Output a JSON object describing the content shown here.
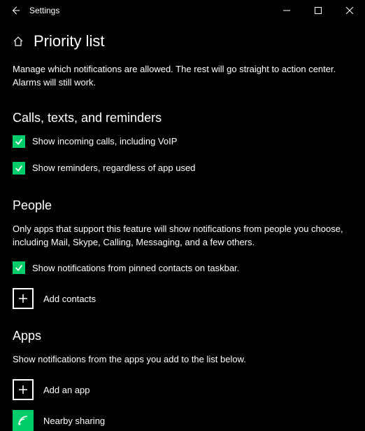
{
  "window": {
    "title": "Settings"
  },
  "page": {
    "heading": "Priority list",
    "description": "Manage which notifications are allowed. The rest will go straight to action center. Alarms will still work."
  },
  "sections": {
    "calls": {
      "heading": "Calls, texts, and reminders",
      "check1": "Show incoming calls, including VoIP",
      "check2": "Show reminders, regardless of app used"
    },
    "people": {
      "heading": "People",
      "note": "Only apps that support this feature will show notifications from people you choose, including Mail, Skype, Calling, Messaging, and a few others.",
      "check1": "Show notifications from pinned contacts on taskbar.",
      "add": "Add contacts"
    },
    "apps": {
      "heading": "Apps",
      "note": "Show notifications from the apps you add to the list below.",
      "add": "Add an app",
      "item1": "Nearby sharing"
    }
  }
}
